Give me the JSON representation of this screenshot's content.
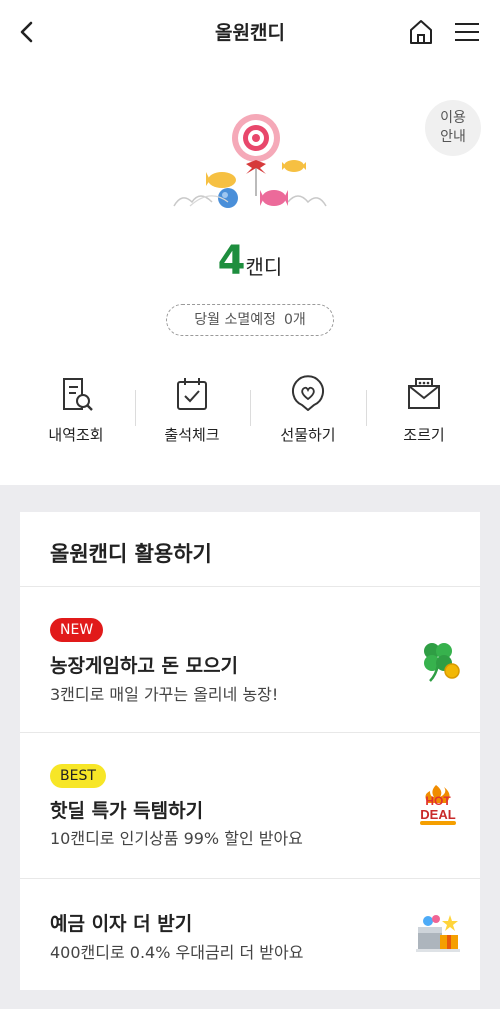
{
  "header": {
    "title": "올원캔디"
  },
  "guide": {
    "line1": "이용",
    "line2": "안내"
  },
  "balance": {
    "count": "4",
    "unit": "캔디"
  },
  "expire": {
    "label": "당월 소멸예정",
    "value": "0개"
  },
  "actions": [
    {
      "label": "내역조회",
      "icon": "history-search-icon"
    },
    {
      "label": "출석체크",
      "icon": "calendar-check-icon"
    },
    {
      "label": "선물하기",
      "icon": "gift-heart-icon"
    },
    {
      "label": "조르기",
      "icon": "envelope-icon"
    }
  ],
  "section": {
    "title": "올원캔디 활용하기",
    "items": [
      {
        "badge": "NEW",
        "title": "농장게임하고 돈 모으기",
        "subtitle": "3캔디로 매일 가꾸는 올리네 농장!",
        "icon": "clover-coin-icon"
      },
      {
        "badge": "BEST",
        "title": "핫딜 특가 득템하기",
        "subtitle": "10캔디로 인기상품 99% 할인 받아요",
        "icon": "hot-deal-icon",
        "icon_text1": "HOT",
        "icon_text2": "DEAL"
      },
      {
        "badge": "",
        "title": "예금 이자 더 받기",
        "subtitle": "400캔디로 0.4% 우대금리 더 받아요",
        "icon": "gift-box-icon"
      }
    ]
  },
  "colors": {
    "accent_green": "#1e8e3e",
    "new_badge": "#e11a1a",
    "best_badge": "#f7e627"
  }
}
